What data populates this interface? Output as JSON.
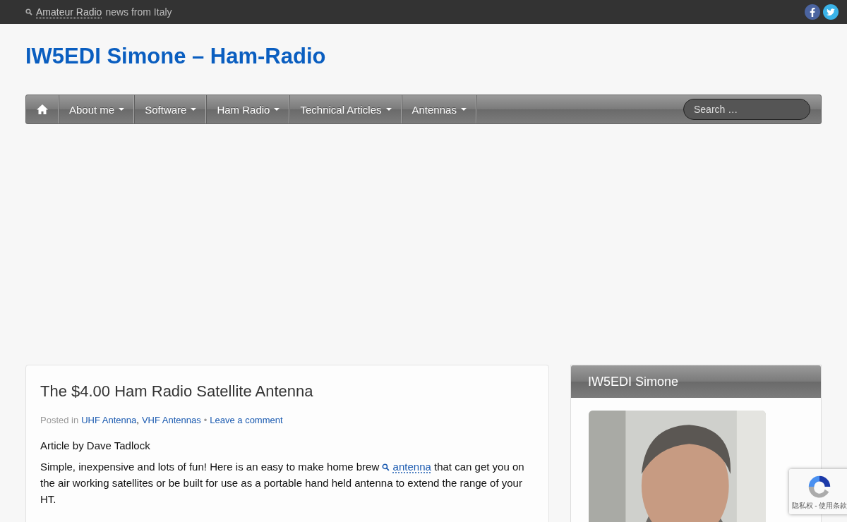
{
  "top_bar": {
    "tagline_link": "Amateur Radio",
    "tagline_text": "news from Italy"
  },
  "site_title": "IW5EDI Simone – Ham-Radio",
  "nav": {
    "items": [
      {
        "label": "About me"
      },
      {
        "label": "Software"
      },
      {
        "label": "Ham Radio"
      },
      {
        "label": "Technical Articles"
      },
      {
        "label": "Antennas"
      }
    ],
    "search": {
      "placeholder": "Search …"
    }
  },
  "article": {
    "title": "The $4.00 Ham Radio Satellite Antenna",
    "posted_in": "Posted in",
    "categories": [
      "UHF Antenna",
      "VHF Antennas"
    ],
    "category_separator": ",",
    "separator": "•",
    "comment_link": "Leave a comment",
    "byline": "Article by Dave Tadlock",
    "paragraph": {
      "before": "Simple, inexpensive and lots of fun! Here is an easy to make home brew",
      "link": "antenna",
      "after": "that can get you on the air working satellites or be built for use as a portable hand held antenna to extend the range of your HT."
    }
  },
  "sidebar": {
    "widget_title": "IW5EDI Simone"
  },
  "recaptcha": {
    "text": "隐私权 - 使用条款"
  }
}
